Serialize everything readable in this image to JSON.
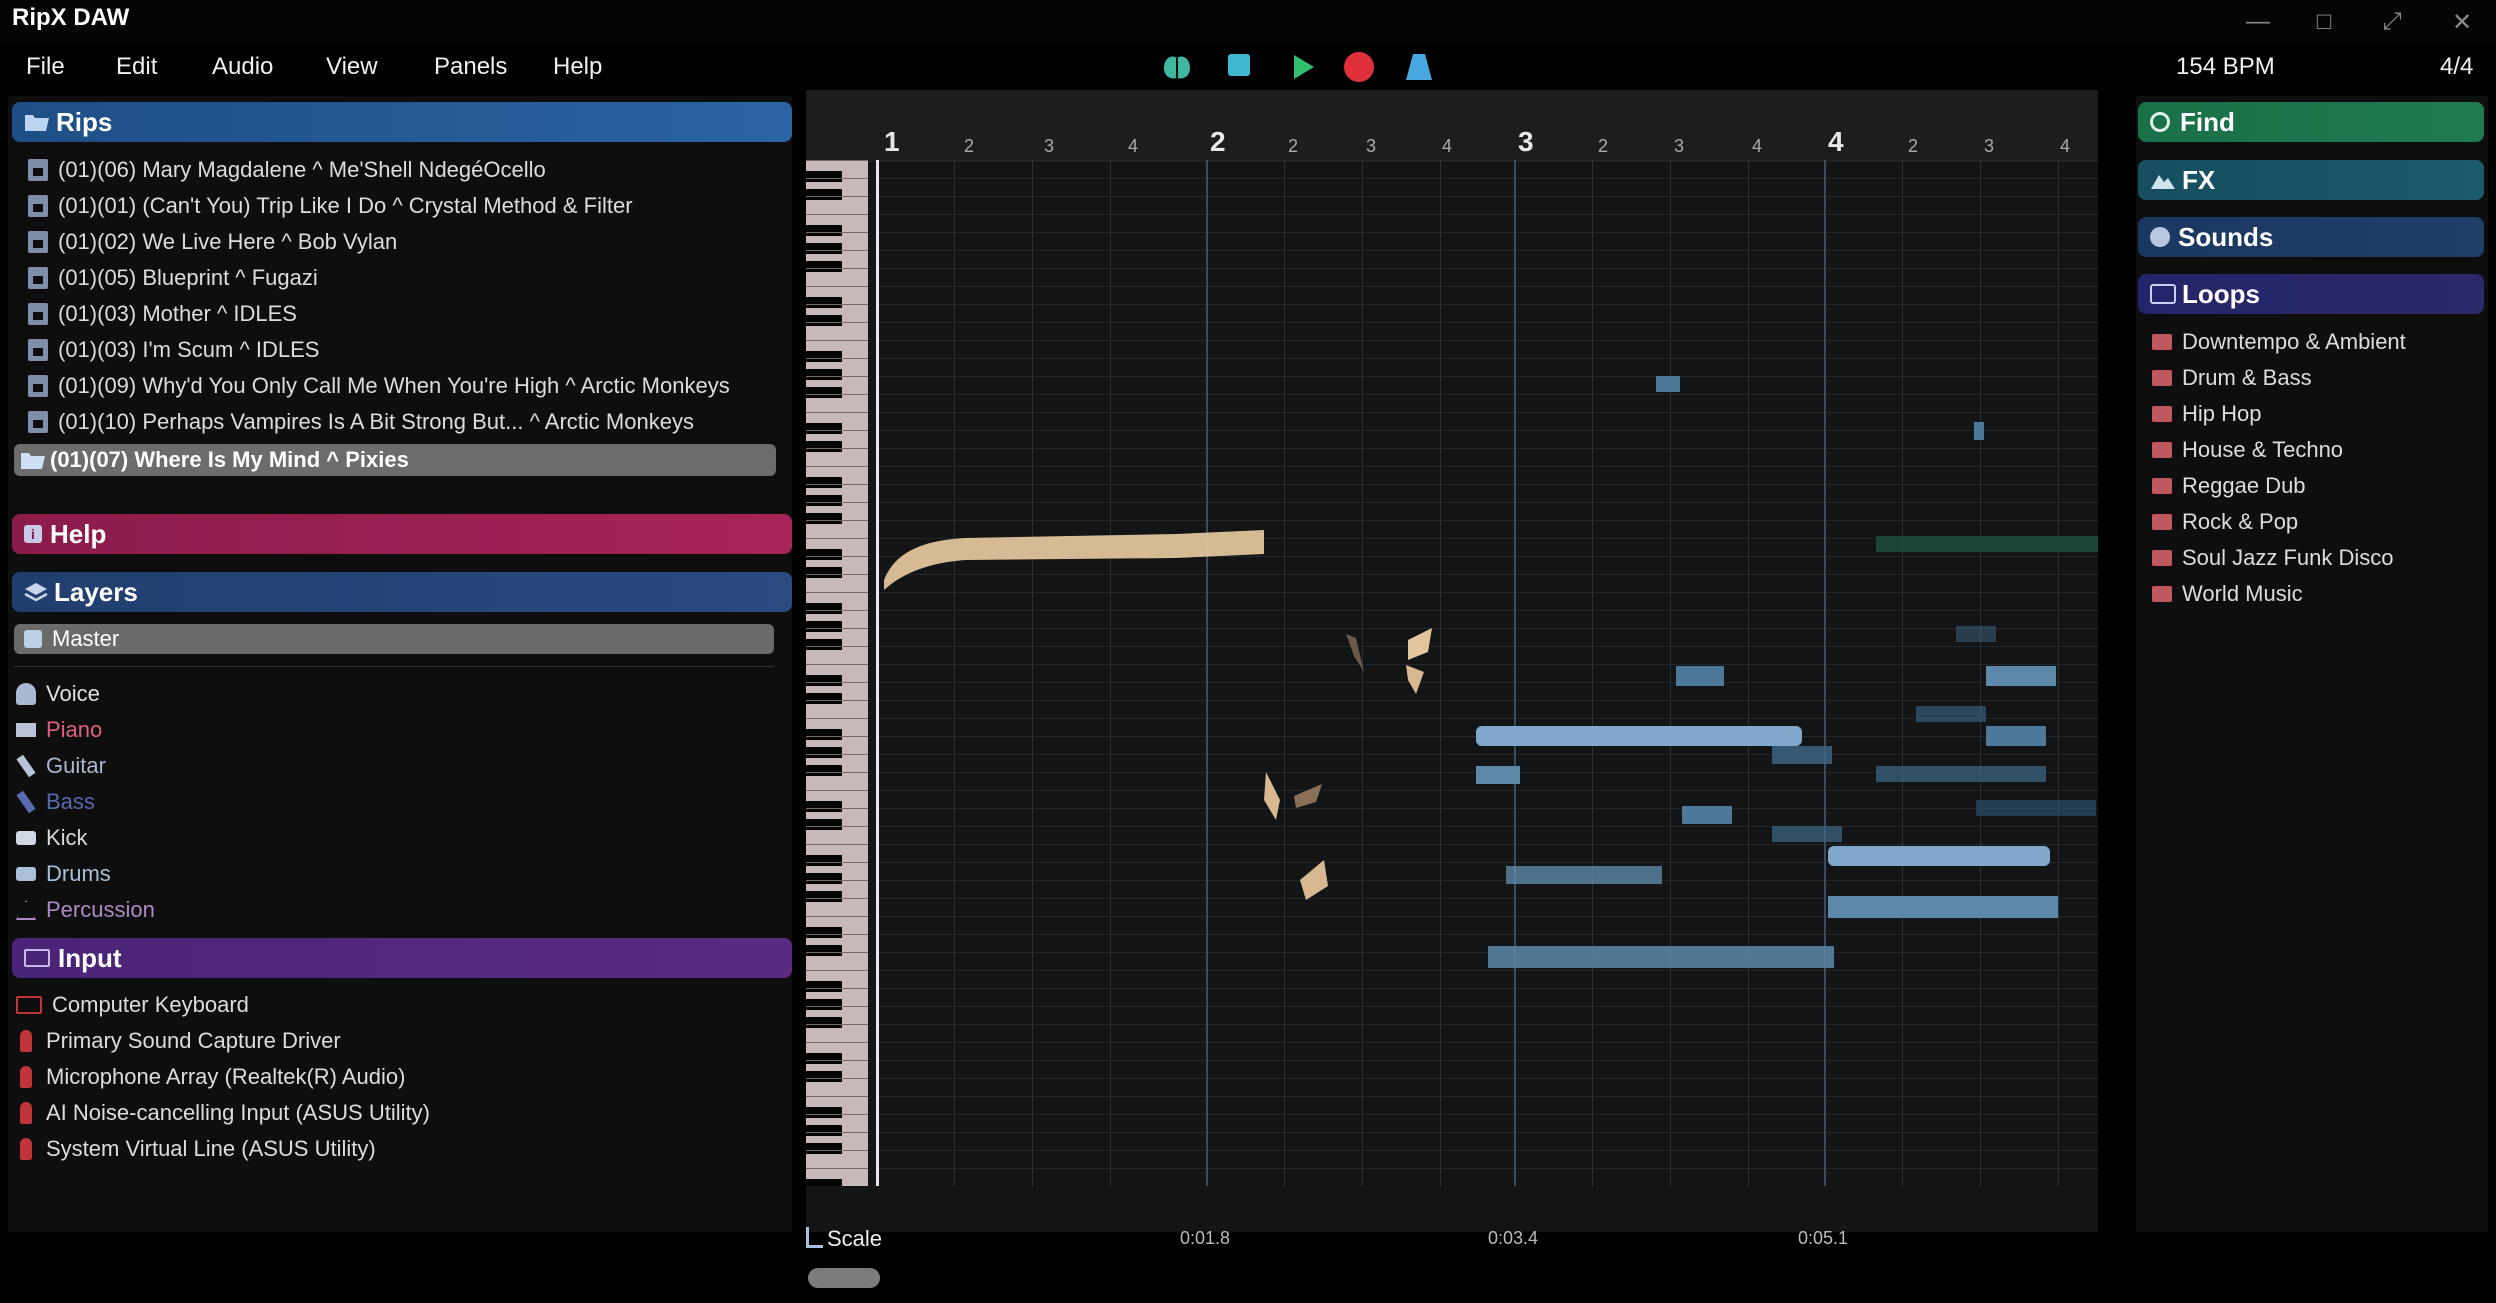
{
  "app": {
    "title": "RipX DAW",
    "window_controls": [
      "—",
      "□",
      "⤢",
      "✕"
    ]
  },
  "menu": [
    "File",
    "Edit",
    "Audio",
    "View",
    "Panels",
    "Help"
  ],
  "transport": {
    "bpm": "154 BPM",
    "time_signature": "4/4",
    "colors": {
      "rip": "#3fb8a0",
      "stop": "#3fb8d0",
      "play": "#2fbf6f",
      "record": "#e0303c",
      "metronome": "#4aa8e0"
    }
  },
  "rips": {
    "title": "Rips",
    "color": "#2a5f9a",
    "items": [
      "(01)(06) Mary Magdalene ^ Me'Shell NdegéOcello",
      "(01)(01) (Can't You) Trip Like I Do ^ Crystal Method & Filter",
      "(01)(02) We Live Here ^ Bob Vylan",
      "(01)(05) Blueprint ^ Fugazi",
      "(01)(03) Mother ^ IDLES",
      "(01)(03) I'm Scum ^ IDLES",
      "(01)(09) Why'd You Only Call Me When You're High ^ Arctic Monkeys",
      "(01)(10) Perhaps Vampires Is A Bit Strong But... ^ Arctic Monkeys"
    ],
    "selected": "(01)(07) Where Is My Mind ^ Pixies"
  },
  "help": {
    "title": "Help",
    "color": "#a8235a"
  },
  "layers": {
    "title": "Layers",
    "color": "#2a4a80",
    "master": "Master",
    "items": [
      {
        "label": "Voice",
        "color": "#e0e0e0",
        "icon": "voice-icon"
      },
      {
        "label": "Piano",
        "color": "#e0607a",
        "icon": "piano-icon"
      },
      {
        "label": "Guitar",
        "color": "#a8b8d0",
        "icon": "guitar-icon"
      },
      {
        "label": "Bass",
        "color": "#5a6ab0",
        "icon": "bass-icon"
      },
      {
        "label": "Kick",
        "color": "#d8d8d8",
        "icon": "kick-icon"
      },
      {
        "label": "Drums",
        "color": "#a8c0d8",
        "icon": "drums-icon"
      },
      {
        "label": "Percussion",
        "color": "#b088c8",
        "icon": "percussion-icon"
      }
    ]
  },
  "input": {
    "title": "Input",
    "color": "#5a2a80",
    "items": [
      {
        "label": "Computer Keyboard",
        "icon": "keyboard-icon"
      },
      {
        "label": "Primary Sound Capture Driver",
        "icon": "microphone-icon"
      },
      {
        "label": "Microphone Array (Realtek(R) Audio)",
        "icon": "microphone-icon"
      },
      {
        "label": "AI Noise-cancelling Input (ASUS Utility)",
        "icon": "microphone-icon"
      },
      {
        "label": "System Virtual Line (ASUS Utility)",
        "icon": "microphone-icon"
      }
    ]
  },
  "ruler": {
    "bars": [
      "1",
      "2",
      "3",
      "4"
    ],
    "beats": [
      "2",
      "3",
      "4"
    ],
    "times": [
      "0:01.8",
      "0:03.4",
      "0:05.1"
    ]
  },
  "scale_label": "Scale",
  "right": {
    "find": {
      "title": "Find",
      "color": "#1f7a50"
    },
    "fx": {
      "title": "FX",
      "color": "#1a5a6a"
    },
    "sounds": {
      "title": "Sounds",
      "color": "#1f3f68"
    },
    "loops": {
      "title": "Loops",
      "color": "#2a2a6a",
      "items": [
        "Downtempo & Ambient",
        "Drum & Bass",
        "Hip Hop",
        "House & Techno",
        "Reggae Dub",
        "Rock & Pop",
        "Soul Jazz Funk Disco",
        "World Music"
      ]
    }
  }
}
